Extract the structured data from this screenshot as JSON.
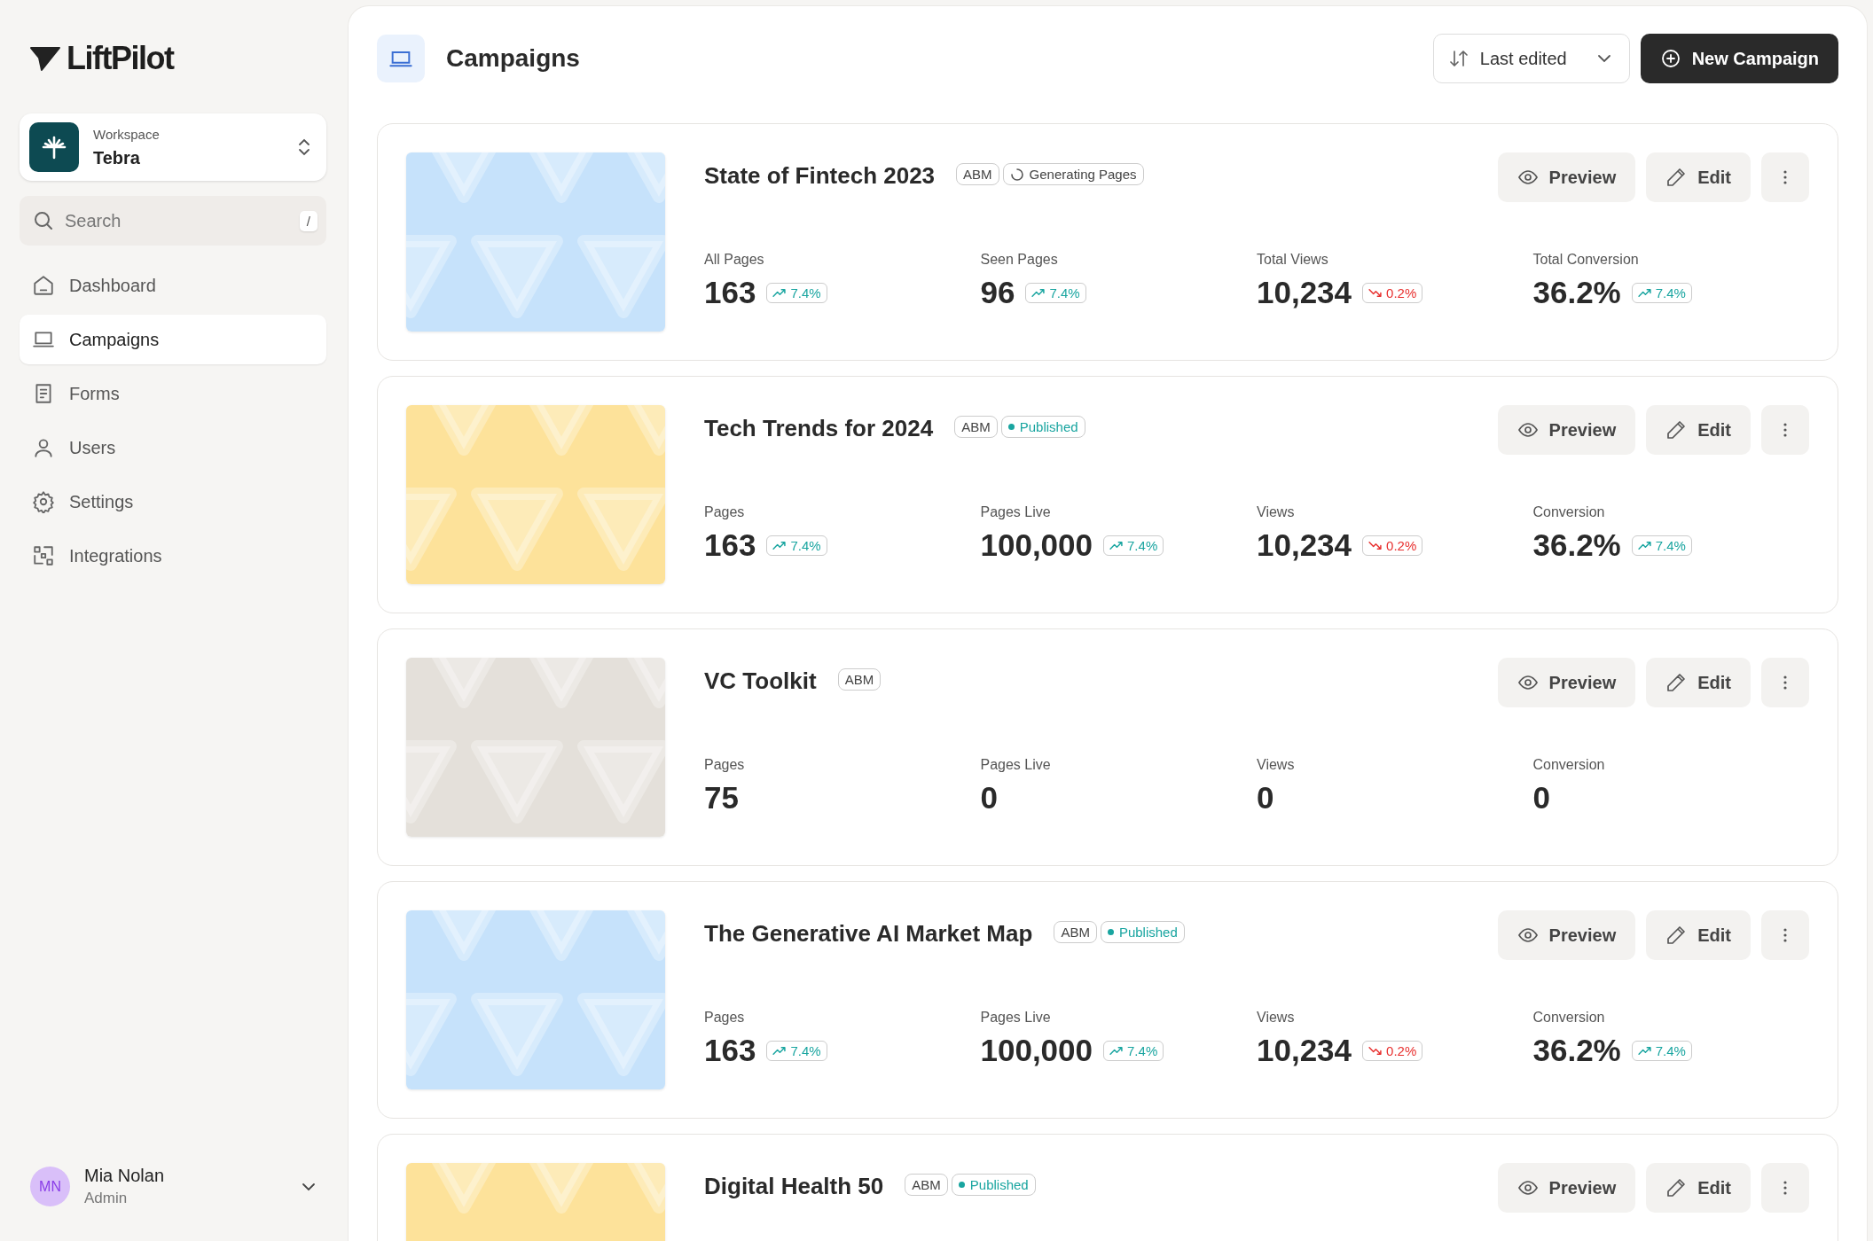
{
  "brand": {
    "name": "LiftPilot"
  },
  "workspace": {
    "label": "Workspace",
    "name": "Tebra"
  },
  "search": {
    "placeholder": "Search",
    "shortcut": "/"
  },
  "nav": [
    {
      "label": "Dashboard",
      "selected": false
    },
    {
      "label": "Campaigns",
      "selected": true
    },
    {
      "label": "Forms",
      "selected": false
    },
    {
      "label": "Users",
      "selected": false
    },
    {
      "label": "Settings",
      "selected": false
    },
    {
      "label": "Integrations",
      "selected": false
    }
  ],
  "user": {
    "initials": "MN",
    "name": "Mia Nolan",
    "role": "Admin"
  },
  "page": {
    "title": "Campaigns",
    "sort": "Last edited",
    "new_button": "New Campaign"
  },
  "campaigns": [
    {
      "title": "State of Fintech 2023",
      "color": "#c6e2fb",
      "tag": "ABM",
      "status": {
        "kind": "generating",
        "label": "Generating Pages"
      },
      "actions": [
        "Preview",
        "Edit"
      ],
      "stats": [
        {
          "label": "All Pages",
          "value": "163",
          "change": {
            "value": "7.4%",
            "negative": false
          }
        },
        {
          "label": "Seen Pages",
          "value": "96",
          "change": {
            "value": "7.4%",
            "negative": false
          }
        },
        {
          "label": "Total Views",
          "value": "10,234",
          "change": {
            "value": "0.2%",
            "negative": true
          }
        },
        {
          "label": "Total Conversion",
          "value": "36.2%",
          "change": {
            "value": "7.4%",
            "negative": false
          }
        }
      ]
    },
    {
      "title": "Tech Trends for 2024",
      "color": "#fde29a",
      "tag": "ABM",
      "status": {
        "kind": "published",
        "label": "Published"
      },
      "actions": [
        "Preview",
        "Edit"
      ],
      "stats": [
        {
          "label": "Pages",
          "value": "163",
          "change": {
            "value": "7.4%",
            "negative": false
          }
        },
        {
          "label": "Pages Live",
          "value": "100,000",
          "change": {
            "value": "7.4%",
            "negative": false
          }
        },
        {
          "label": "Views",
          "value": "10,234",
          "change": {
            "value": "0.2%",
            "negative": true
          }
        },
        {
          "label": "Conversion",
          "value": "36.2%",
          "change": {
            "value": "7.4%",
            "negative": false
          }
        }
      ]
    },
    {
      "title": "VC Toolkit",
      "color": "#e4e0da",
      "tag": "ABM",
      "actions": [
        "Preview",
        "Edit"
      ],
      "stats": [
        {
          "label": "Pages",
          "value": "75"
        },
        {
          "label": "Pages Live",
          "value": "0"
        },
        {
          "label": "Views",
          "value": "0"
        },
        {
          "label": "Conversion",
          "value": "0"
        }
      ]
    },
    {
      "title": "The Generative AI Market Map",
      "color": "#c6e2fb",
      "tag": "ABM",
      "status": {
        "kind": "published",
        "label": "Published"
      },
      "actions": [
        "Preview",
        "Edit"
      ],
      "stats": [
        {
          "label": "Pages",
          "value": "163",
          "change": {
            "value": "7.4%",
            "negative": false
          }
        },
        {
          "label": "Pages Live",
          "value": "100,000",
          "change": {
            "value": "7.4%",
            "negative": false
          }
        },
        {
          "label": "Views",
          "value": "10,234",
          "change": {
            "value": "0.2%",
            "negative": true
          }
        },
        {
          "label": "Conversion",
          "value": "36.2%",
          "change": {
            "value": "7.4%",
            "negative": false
          }
        }
      ]
    },
    {
      "title": "Digital Health 50",
      "color": "#fde29a",
      "tag": "ABM",
      "status": {
        "kind": "published",
        "label": "Published"
      },
      "actions": [
        "Preview",
        "Edit"
      ]
    }
  ]
}
